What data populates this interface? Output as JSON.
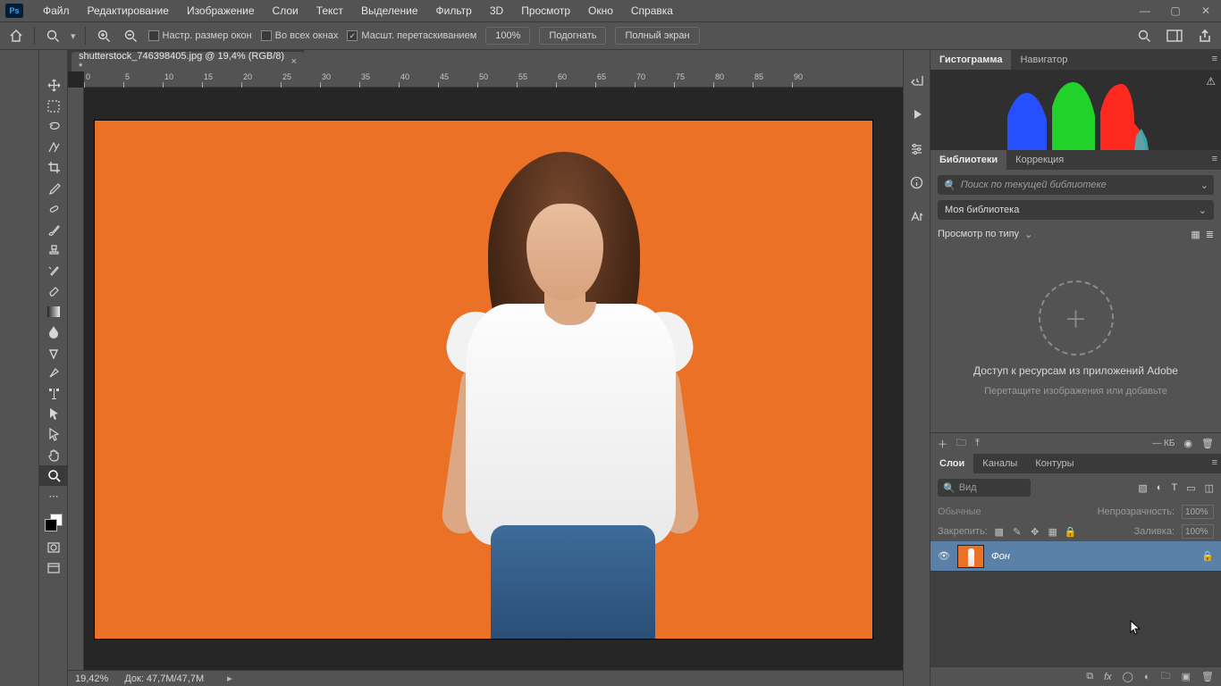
{
  "menubar": {
    "items": [
      "Файл",
      "Редактирование",
      "Изображение",
      "Слои",
      "Текст",
      "Выделение",
      "Фильтр",
      "3D",
      "Просмотр",
      "Окно",
      "Справка"
    ]
  },
  "options": {
    "chk_resize": "Настр. размер окон",
    "chk_all": "Во всех окнах",
    "chk_scrub": "Масшт. перетаскиванием",
    "zoom_field": "100%",
    "btn_fit": "Подогнать",
    "btn_full": "Полный экран"
  },
  "tab": {
    "title": "shutterstock_746398405.jpg @ 19,4% (RGB/8) *"
  },
  "ruler": {
    "ticks": [
      "0",
      "5",
      "10",
      "15",
      "20",
      "25",
      "30",
      "35",
      "40",
      "45",
      "50",
      "55",
      "60",
      "65",
      "70",
      "75",
      "80",
      "85",
      "90"
    ]
  },
  "status": {
    "zoom": "19,42%",
    "doc": "Док: 47,7M/47,7M"
  },
  "panels": {
    "hist_tab": "Гистограмма",
    "nav_tab": "Навигатор",
    "lib_tab": "Библиотеки",
    "corr_tab": "Коррекция",
    "search_placeholder": "Поиск по текущей библиотеке",
    "library_name": "Моя библиотека",
    "view_label": "Просмотр по типу",
    "drop_line1": "Доступ к ресурсам из приложений Adobe",
    "drop_line2": "Перетащите изображения или добавьте",
    "kb_label": "— КБ",
    "layers_tab": "Слои",
    "channels_tab": "Каналы",
    "paths_tab": "Контуры",
    "search_layers": "Вид",
    "blend_mode": "Обычные",
    "opacity_label": "Непрозрачность:",
    "opacity_val": "100%",
    "lock_label": "Закрепить:",
    "fill_label": "Заливка:",
    "fill_val": "100%",
    "layer_name": "Фон"
  }
}
